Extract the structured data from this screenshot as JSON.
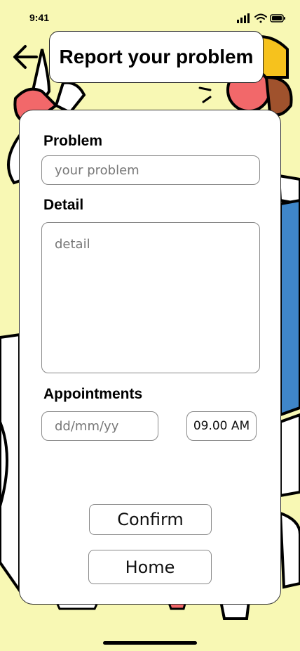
{
  "status_bar": {
    "time": "9:41"
  },
  "header": {
    "title": "Report your problem"
  },
  "form": {
    "problem_label": "Problem",
    "problem_placeholder": "your problem",
    "detail_label": "Detail",
    "detail_placeholder": "detail",
    "appointments_label": "Appointments",
    "date_placeholder": "dd/mm/yy",
    "time_value": "09.00 AM"
  },
  "actions": {
    "confirm_label": "Confirm",
    "home_label": "Home"
  },
  "colors": {
    "background": "#f8f8b4",
    "accent_blue": "#3f86c9",
    "accent_red": "#f2686a",
    "accent_yellow": "#f6c21d"
  }
}
